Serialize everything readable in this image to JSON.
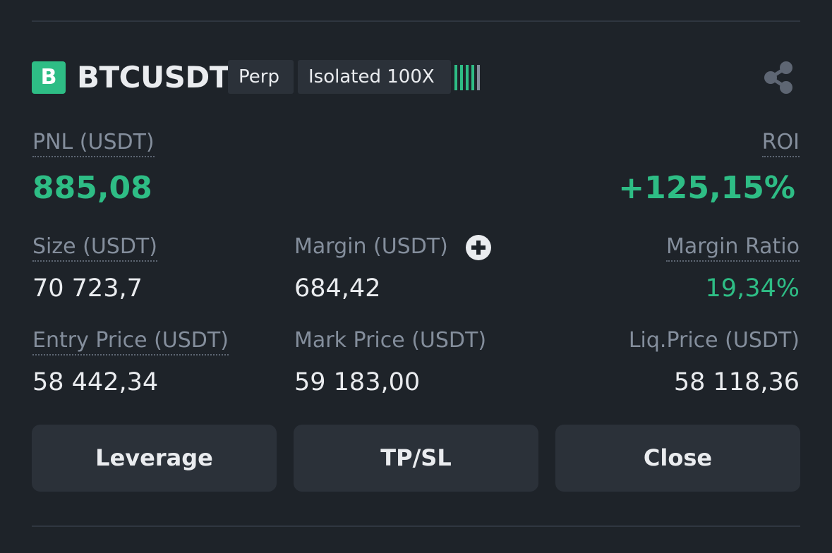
{
  "position": {
    "badge_letter": "B",
    "symbol": "BTCUSDT",
    "contract_type": "Perp",
    "margin_mode": "Isolated 100X",
    "leverage_level": {
      "filled": 4,
      "total": 5
    },
    "share_icon": "share-icon"
  },
  "pnl": {
    "label": "PNL (USDT)",
    "value": "885,08"
  },
  "roi": {
    "label": "ROI",
    "value": "+125,15%"
  },
  "size": {
    "label": "Size (USDT)",
    "value": "70 723,7"
  },
  "margin": {
    "label": "Margin (USDT)",
    "value": "684,42",
    "add_icon": "plus-circle-icon"
  },
  "margin_ratio": {
    "label": "Margin Ratio",
    "value": "19,34%"
  },
  "entry_price": {
    "label": "Entry Price (USDT)",
    "value": "58 442,34"
  },
  "mark_price": {
    "label": "Mark Price (USDT)",
    "value": "59 183,00"
  },
  "liq_price": {
    "label": "Liq.Price (USDT)",
    "value": "58 118,36"
  },
  "actions": {
    "leverage": "Leverage",
    "tpsl": "TP/SL",
    "close": "Close"
  },
  "colors": {
    "background": "#1e2329",
    "positive": "#2ebd85",
    "muted": "#848e9c",
    "button": "#2b3139"
  }
}
